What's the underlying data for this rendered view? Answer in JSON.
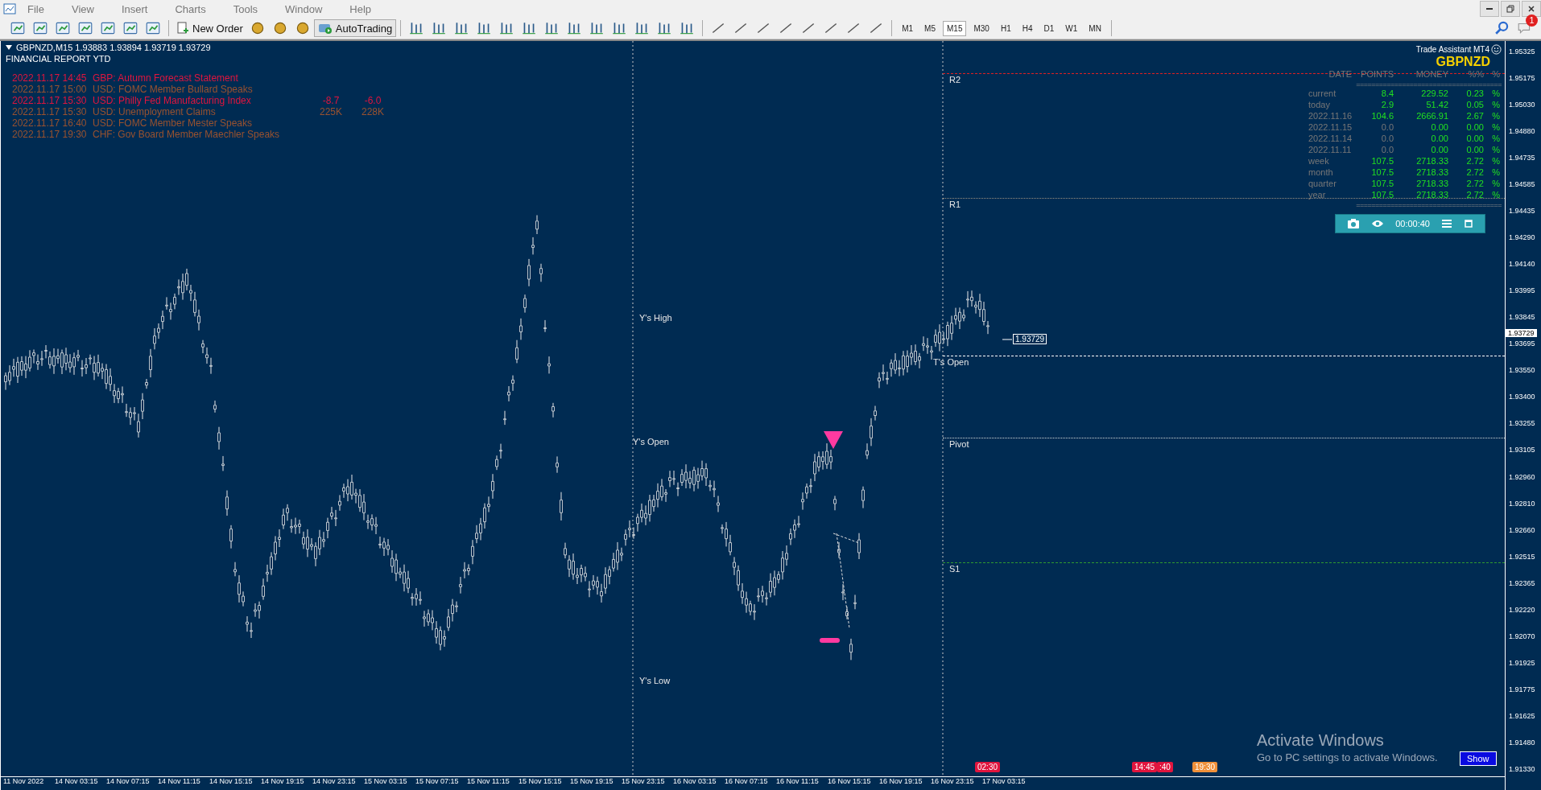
{
  "menu": [
    "File",
    "View",
    "Insert",
    "Charts",
    "Tools",
    "Window",
    "Help"
  ],
  "toolbar": {
    "new_order": "New Order",
    "auto_trading": "AutoTrading",
    "timeframes": [
      {
        "label": "M1",
        "selected": false
      },
      {
        "label": "M5",
        "selected": false
      },
      {
        "label": "M15",
        "selected": true
      },
      {
        "label": "M30",
        "selected": false
      },
      {
        "label": "H1",
        "selected": false
      },
      {
        "label": "H4",
        "selected": false
      },
      {
        "label": "D1",
        "selected": false
      },
      {
        "label": "W1",
        "selected": false
      },
      {
        "label": "MN",
        "selected": false
      }
    ],
    "notification_badge": "1"
  },
  "chart": {
    "header": "GBPNZD,M15  1.93883 1.93894 1.93719 1.93729",
    "subtitle": "FINANCIAL REPORT YTD",
    "news": [
      {
        "date": "2022.11.17 14:45",
        "event": "GBP: Autumn Forecast Statement",
        "color": "#e0153e"
      },
      {
        "date": "2022.11.17 15:00",
        "event": "USD: FOMC Member Bullard Speaks",
        "color": "#99522f"
      },
      {
        "date": "2022.11.17 15:30",
        "event": "USD: Philly Fed Manufacturing Index",
        "actual": "-8.7",
        "forecast": "-6.0",
        "color": "#e0153e"
      },
      {
        "date": "2022.11.17 15:30",
        "event": "USD: Unemployment Claims",
        "actual": "225K",
        "forecast": "228K",
        "color": "#99522f"
      },
      {
        "date": "2022.11.17 16:40",
        "event": "USD: FOMC Member Mester Speaks",
        "color": "#99522f"
      },
      {
        "date": "2022.11.17 19:30",
        "event": "CHF: Gov Board Member Maechler Speaks",
        "color": "#99522f"
      }
    ],
    "levels": [
      {
        "label": "R2",
        "color": "#e02020"
      },
      {
        "label": "R1",
        "color": "#9a8f80"
      },
      {
        "label": "T's Open",
        "color": "#ffffff"
      },
      {
        "label": "Pivot",
        "color": "#d8d8d8"
      },
      {
        "label": "S1",
        "color": "#2e9a2e"
      }
    ],
    "yesterday_labels": [
      "Y's High",
      "Y's Open",
      "Y's Low"
    ],
    "price_tag": "1.93729",
    "event_markers": [
      {
        "label": "02:30",
        "color": "#e0153e"
      },
      {
        "label": "14:45",
        "color": "#e0153e"
      },
      {
        "label": ":40",
        "color": "#e0153e"
      },
      {
        "label": "19:30",
        "color": "#f0903a"
      }
    ],
    "show_button": "Show"
  },
  "trade_assistant": {
    "title": "Trade Assistant MT4",
    "symbol": "GBPNZD",
    "columns": [
      "DATE",
      "POINTS",
      "MONEY",
      "%%",
      "%"
    ],
    "separator": "======================================",
    "rows": [
      {
        "date": "current",
        "points": "8.4",
        "money": "229.52",
        "percent": "0.23",
        "unit": "%",
        "points_active": true
      },
      {
        "date": "today",
        "points": "2.9",
        "money": "51.42",
        "percent": "0.05",
        "unit": "%",
        "points_active": true
      },
      {
        "date": "2022.11.16",
        "points": "104.6",
        "money": "2666.91",
        "percent": "2.67",
        "unit": "%",
        "points_active": true
      },
      {
        "date": "2022.11.15",
        "points": "0.0",
        "money": "0.00",
        "percent": "0.00",
        "unit": "%",
        "points_active": false
      },
      {
        "date": "2022.11.14",
        "points": "0.0",
        "money": "0.00",
        "percent": "0.00",
        "unit": "%",
        "points_active": false
      },
      {
        "date": "2022.11.11",
        "points": "0.0",
        "money": "0.00",
        "percent": "0.00",
        "unit": "%",
        "points_active": false
      },
      {
        "date": "week",
        "points": "107.5",
        "money": "2718.33",
        "percent": "2.72",
        "unit": "%",
        "points_active": true
      },
      {
        "date": "month",
        "points": "107.5",
        "money": "2718.33",
        "percent": "2.72",
        "unit": "%",
        "points_active": true
      },
      {
        "date": "quarter",
        "points": "107.5",
        "money": "2718.33",
        "percent": "2.72",
        "unit": "%",
        "points_active": true
      },
      {
        "date": "year",
        "points": "107.5",
        "money": "2718.33",
        "percent": "2.72",
        "unit": "%",
        "points_active": true
      }
    ],
    "timer": "00:00:40"
  },
  "price_axis": {
    "labels": [
      "1.95325",
      "1.95175",
      "1.95030",
      "1.94880",
      "1.94735",
      "1.94585",
      "1.94435",
      "1.94290",
      "1.94140",
      "1.93995",
      "1.93845",
      "1.93695",
      "1.93550",
      "1.93400",
      "1.93255",
      "1.93105",
      "1.92960",
      "1.92810",
      "1.92660",
      "1.92515",
      "1.92365",
      "1.92220",
      "1.92070",
      "1.91925",
      "1.91775",
      "1.91625",
      "1.91480",
      "1.91330"
    ],
    "current": "1.93729"
  },
  "time_axis": [
    "11 Nov 2022",
    "14 Nov 03:15",
    "14 Nov 07:15",
    "14 Nov 11:15",
    "14 Nov 15:15",
    "14 Nov 19:15",
    "14 Nov 23:15",
    "15 Nov 03:15",
    "15 Nov 07:15",
    "15 Nov 11:15",
    "15 Nov 15:15",
    "15 Nov 19:15",
    "15 Nov 23:15",
    "16 Nov 03:15",
    "16 Nov 07:15",
    "16 Nov 11:15",
    "16 Nov 15:15",
    "16 Nov 19:15",
    "16 Nov 23:15",
    "17 Nov 03:15"
  ],
  "os_notice": {
    "title": "Activate Windows",
    "text": "Go to PC settings to activate Windows."
  }
}
